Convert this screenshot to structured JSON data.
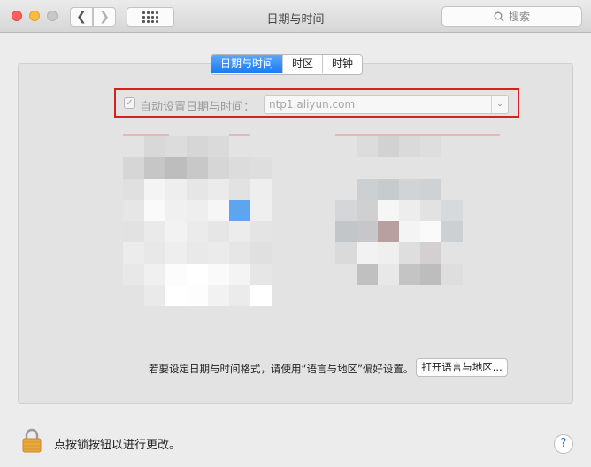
{
  "window": {
    "title": "日期与时间",
    "search_placeholder": "搜索"
  },
  "icons": {
    "back": "chevron-left-icon",
    "forward": "chevron-right-icon",
    "grid": "grid-icon",
    "search": "search-icon",
    "lock": "lock-icon",
    "help": "help-icon"
  },
  "tabs": [
    {
      "label": "日期与时间",
      "active": true
    },
    {
      "label": "时区",
      "active": false
    },
    {
      "label": "时钟",
      "active": false
    }
  ],
  "auto_time": {
    "label": "自动设置日期与时间：",
    "checked": true,
    "server": "ntp1.aliyun.com"
  },
  "footer": {
    "format_text": "若要设定日期与时间格式，请使用“语言与地区”偏好设置。",
    "open_language_button": "打开语言与地区...",
    "lock_text": "点按锁按钮以进行更改。",
    "help_label": "?"
  },
  "colors": {
    "accent": "#1b7cf5",
    "highlight_border": "#d61f1f",
    "close": "#fc605c",
    "minimize": "#fdbc40"
  }
}
